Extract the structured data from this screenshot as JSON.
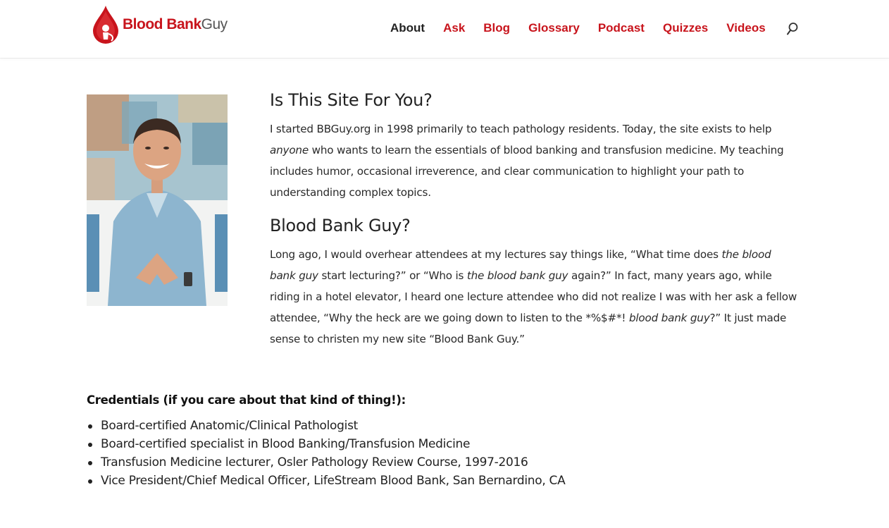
{
  "brand": {
    "name_red": "Blood Bank",
    "name_gray": "Guy",
    "color": "#c8141c"
  },
  "nav": {
    "items": [
      {
        "label": "About",
        "active": true
      },
      {
        "label": "Ask"
      },
      {
        "label": "Blog"
      },
      {
        "label": "Glossary"
      },
      {
        "label": "Podcast"
      },
      {
        "label": "Quizzes"
      },
      {
        "label": "Videos"
      }
    ],
    "search_icon": "search-icon"
  },
  "section1": {
    "heading": "Is This Site For You?",
    "p_a": "I started BBGuy.org in 1998 primarily to teach pathology residents. Today, the site exists to help ",
    "p_em": "anyone",
    "p_b": " who wants to learn the essentials of blood banking and transfusion medicine. My teaching includes humor, occasional irreverence, and clear communication to highlight your path to understanding complex topics."
  },
  "section2": {
    "heading": "Blood Bank Guy?",
    "t1": "Long ago, I would overhear attendees at my lectures say things like, “What time does ",
    "e1": "the blood bank guy",
    "t2": " start lecturing?” or “Who is ",
    "e2": "the blood bank guy",
    "t3": " again?” In fact, many years ago, while riding in a hotel elevator, I heard one lecture attendee who did not realize I was with her ask a fellow attendee, “Why the heck are we going down to listen to the *%$#*! ",
    "e3": "blood bank guy",
    "t4": "?” It just made sense to christen my new site “Blood Bank Guy.”"
  },
  "credentials": {
    "title": "Credentials (if you care about that kind of thing!):",
    "items": [
      "Board-certified Anatomic/Clinical Pathologist",
      "Board-certified specialist in Blood Banking/Transfusion Medicine",
      "Transfusion Medicine lecturer, Osler Pathology Review Course, 1997-2016",
      "Vice President/Chief Medical Officer, LifeStream Blood Bank, San Bernardino, CA"
    ]
  }
}
